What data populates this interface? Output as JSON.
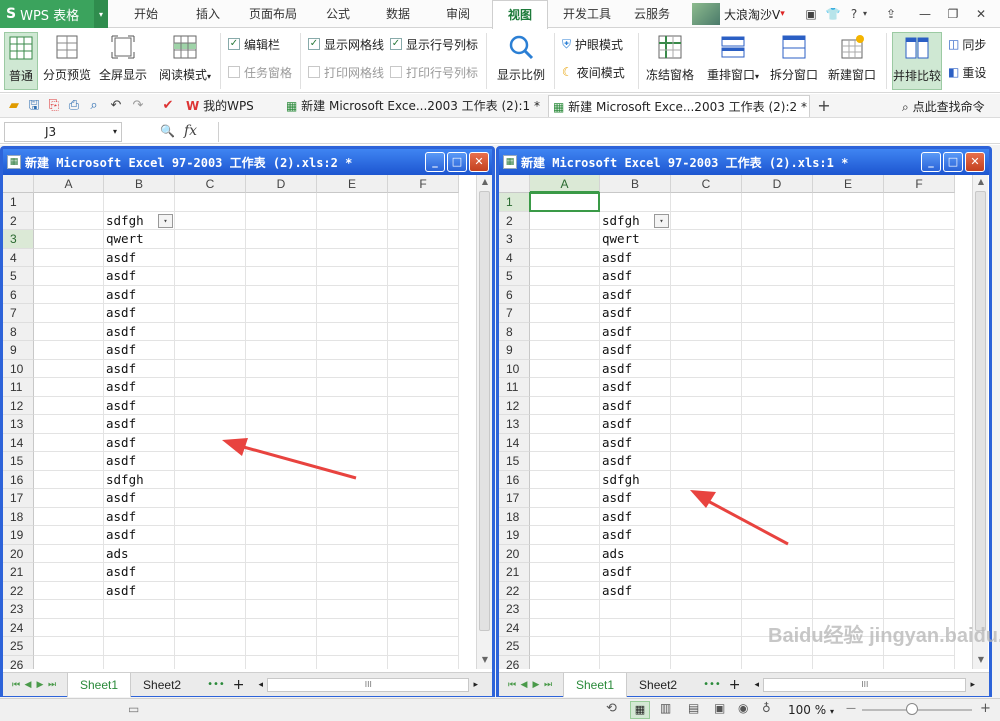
{
  "app": {
    "logo": "S",
    "name": "WPS 表格",
    "menu_arrow": "▾"
  },
  "tabs": [
    "开始",
    "插入",
    "页面布局",
    "公式",
    "数据",
    "审阅",
    "视图",
    "开发工具",
    "云服务"
  ],
  "active_tab": "视图",
  "user": {
    "name": "大浪淘沙V",
    "arrow": "▾"
  },
  "title_buttons": {
    "skin": "▣",
    "shirt": "👕",
    "help": "?",
    "help_arrow": "▾",
    "upload": "⇪",
    "minimize": "—",
    "restore": "❐",
    "close": "✕"
  },
  "ribbon": {
    "normal": "普通",
    "page_break": "分页预览",
    "fullscreen": "全屏显示",
    "reading": "阅读模式",
    "reading_arrow": "▾",
    "formula_bar": "编辑栏",
    "task_pane": "任务窗格",
    "show_gridlines": "显示网格线",
    "print_gridlines": "打印网格线",
    "show_headers": "显示行号列标",
    "print_headers": "打印行号列标",
    "zoom": "显示比例",
    "eye_mode": "护眼模式",
    "night_mode": "夜间模式",
    "freeze": "冻结窗格",
    "arrange": "重排窗口",
    "arrange_arrow": "▾",
    "split": "拆分窗口",
    "new_window": "新建窗口",
    "side_by_side": "并排比较",
    "sync_scroll": "同步",
    "reset_pos": "重设"
  },
  "quickbar": {
    "doc_tabs": [
      "我的WPS",
      "新建 Microsoft Exce...2003 工作表 (2):1 *",
      "新建 Microsoft Exce...2003 工作表 (2):2 *"
    ],
    "tab_close": "×",
    "add_tab": "+",
    "search": "点此查找命令"
  },
  "formula": {
    "namebox": "J3",
    "namebox_arrow": "▾",
    "fx": "fx",
    "zoom_icon": "🔍"
  },
  "windows": [
    {
      "title": "新建 Microsoft Excel 97-2003 工作表 (2).xls:2 *",
      "active_row": 3,
      "active_col": null
    },
    {
      "title": "新建 Microsoft Excel 97-2003 工作表 (2).xls:1 *",
      "active_row": 1,
      "active_col": "A"
    }
  ],
  "window_buttons": {
    "min": "_",
    "max": "□",
    "close": "✕"
  },
  "columns": [
    "A",
    "B",
    "C",
    "D",
    "E",
    "F"
  ],
  "rows": [
    "1",
    "2",
    "3",
    "4",
    "5",
    "6",
    "7",
    "8",
    "9",
    "10",
    "11",
    "12",
    "13",
    "14",
    "15",
    "16",
    "17",
    "18",
    "19",
    "20",
    "21",
    "22",
    "23",
    "24",
    "25",
    "26"
  ],
  "colB": [
    "",
    "sdfgh",
    "qwert",
    "asdf",
    "asdf",
    "asdf",
    "asdf",
    "asdf",
    "asdf",
    "asdf",
    "asdf",
    "asdf",
    "asdf",
    "asdf",
    "asdf",
    "sdfgh",
    "asdf",
    "asdf",
    "asdf",
    "ads",
    "asdf",
    "asdf",
    "",
    "",
    "",
    ""
  ],
  "dropdown_glyph": "▾",
  "sheets": [
    "Sheet1",
    "Sheet2"
  ],
  "active_sheet": "Sheet1",
  "sheet_nav": {
    "first": "⏮",
    "prev": "◀",
    "next": "▶",
    "last": "⏭",
    "more": "•••",
    "add": "+",
    "scroll_left": "◂",
    "scroll_right": "▸",
    "scroll_thumb": "III"
  },
  "status": {
    "zoom": "100 %",
    "zoom_arrow": "▾",
    "minus": "—",
    "plus": "+"
  },
  "watermark": "Baidu经验 jingyan.baidu.com",
  "colors": {
    "brand": "#3ba35d",
    "window_border": "#2d63d9",
    "selection": "#3a9a47",
    "arrow": "#e8433f"
  }
}
